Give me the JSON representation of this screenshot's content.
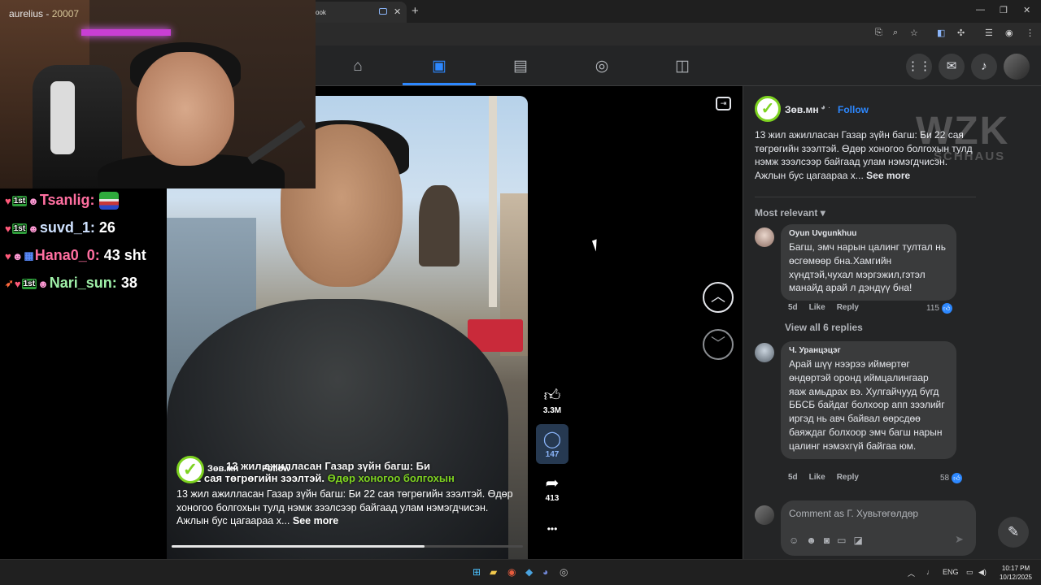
{
  "browser": {
    "tab_title": "ook",
    "new_tab": "+",
    "tab_close": "✕",
    "window_controls": [
      "—",
      "❐",
      "✕"
    ]
  },
  "fb_nav": {
    "active_tab": "reels"
  },
  "webcam": {
    "streamer": "aurelius",
    "points": "20007",
    "chat": [
      {
        "user": "Tsanlig:",
        "message": ""
      },
      {
        "user": "suvd_1:",
        "message": "26"
      },
      {
        "user": "Hana0_0:",
        "message": "43 sht"
      },
      {
        "user": "Nari_sun:",
        "message": "38"
      }
    ]
  },
  "reel": {
    "author": "Зөв.мн",
    "follow_label": "Follow",
    "burned_line1": "13 жил ажилласан Газар зүйн багш: Би",
    "burned_line2_a": "2 сая төгрөгийн зээлтэй. ",
    "burned_line2_b": "Өдөр хоногоо болгохын",
    "caption": "13 жил ажилласан Газар зүйн багш: Би 22 сая төгрөгийн зээлтэй. Өдөр хоногоо болгохын тулд нэмж зээлсээр байгаад улам нэмэгдчисэн. Ажлын бус цагаараа х...",
    "see_more": "See more",
    "likes": "3.3M",
    "comments": "147",
    "shares": "413",
    "more": "•••",
    "progress": 0.72
  },
  "panel": {
    "author": "Зөв.мн",
    "separator": "·",
    "follow_label": "Follow",
    "post_text": "13 жил ажилласан Газар зүйн багш: Би 22 сая төгрөгийн зээлтэй. Өдөр хоногоо болгохын тулд нэмж зээлсээр байгаад улам нэмэгдчисэн. Ажлын бус цагаараа х...",
    "see_more": "See more",
    "sort_label": "Most relevant",
    "comments": [
      {
        "name": "Oyun Uvgunkhuu",
        "text": "Багш, эмч нарын цалинг тултал нь өсгөмөөр бна.Хамгийн хүндтэй,чухал мэргэжил,гэтэл манайд арай л дэндүү бна!",
        "age": "5d",
        "like": "Like",
        "reply": "Reply",
        "reactions": "115"
      },
      {
        "name": "Ч. Уранцэцэг",
        "text": "Арай шүү нээрээ иймөртөг өндөртэй оронд иймцалингаар яаж амьдрах вэ. Хулгайчууд бүгд ББСБ байдаг болхоор апп зээлийг иргэд нь авч байвал өөрсдөө баяждаг болхоор эмч багш нарын цалинг нэмэхгүй байгаа юм.",
        "age": "5d",
        "like": "Like",
        "reply": "Reply",
        "reactions": "58"
      }
    ],
    "view_replies": "View all 6 replies",
    "composer_placeholder": "Comment as Г. Хувьтөгөлдөр"
  },
  "watermark": {
    "main": "WZK",
    "sub": "SCHHAUS"
  },
  "taskbar": {
    "lang": "ENG",
    "time": "10:17 PM",
    "date": "10/12/2025"
  }
}
